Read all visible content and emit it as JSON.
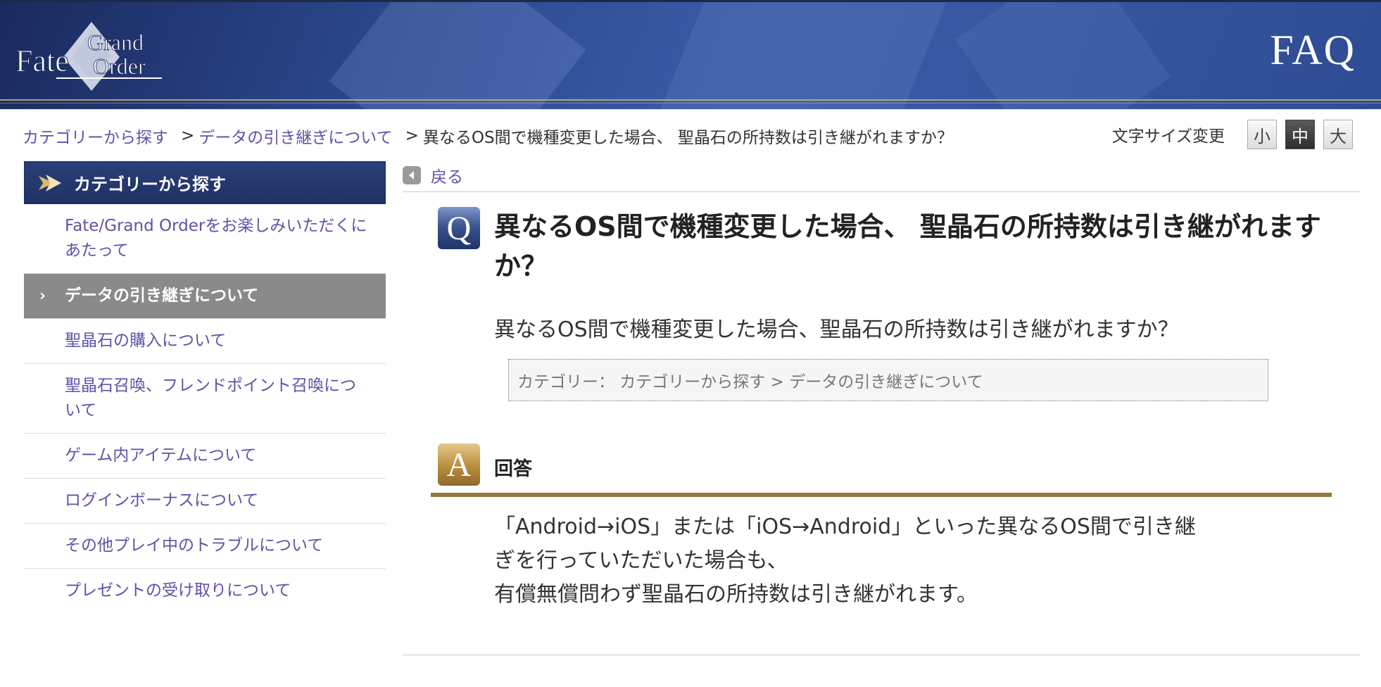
{
  "header": {
    "logo_text": "Fate Grand Order",
    "title": "FAQ"
  },
  "breadcrumb": {
    "items": [
      "カテゴリーから探す",
      "データの引き継ぎについて"
    ],
    "separator": ">",
    "current": "異なるOS間で機種変更した場合、 聖晶石の所持数は引き継がれますか？"
  },
  "font_size": {
    "label": "文字サイズ変更",
    "options": [
      "小",
      "中",
      "大"
    ],
    "selected": "中"
  },
  "sidebar": {
    "heading": "カテゴリーから探す",
    "active_marker": "›",
    "items": [
      {
        "label": "Fate/Grand Orderをお楽しみいただくにあたって",
        "active": false
      },
      {
        "label": "データの引き継ぎについて",
        "active": true
      },
      {
        "label": "聖晶石の購入について",
        "active": false
      },
      {
        "label": "聖晶石召喚、フレンドポイント召喚について",
        "active": false
      },
      {
        "label": "ゲーム内アイテムについて",
        "active": false
      },
      {
        "label": "ログインボーナスについて",
        "active": false
      },
      {
        "label": "その他プレイ中のトラブルについて",
        "active": false
      },
      {
        "label": "プレゼントの受け取りについて",
        "active": false
      }
    ]
  },
  "main": {
    "back_label": "戻る",
    "question": {
      "icon_letter": "Q",
      "title": "異なるOS間で機種変更した場合、 聖晶石の所持数は引き継がれますか？",
      "body": "異なるOS間で機種変更した場合、聖晶石の所持数は引き継がれますか？"
    },
    "category_line": "カテゴリー： カテゴリーから探す > データの引き継ぎについて",
    "answer": {
      "icon_letter": "A",
      "label": "回答",
      "line1": "「Android→iOS」または「iOS→Android」といった異なるOS間で引き継",
      "line2": "ぎを行っていただいた場合も、",
      "line3": "有償無償問わず聖晶石の所持数は引き継がれます。"
    }
  },
  "colors": {
    "header_blue": "#2c4a90",
    "link": "#5b54a8",
    "active_item": "#8a8a8a",
    "answer_rule": "#93773f"
  }
}
